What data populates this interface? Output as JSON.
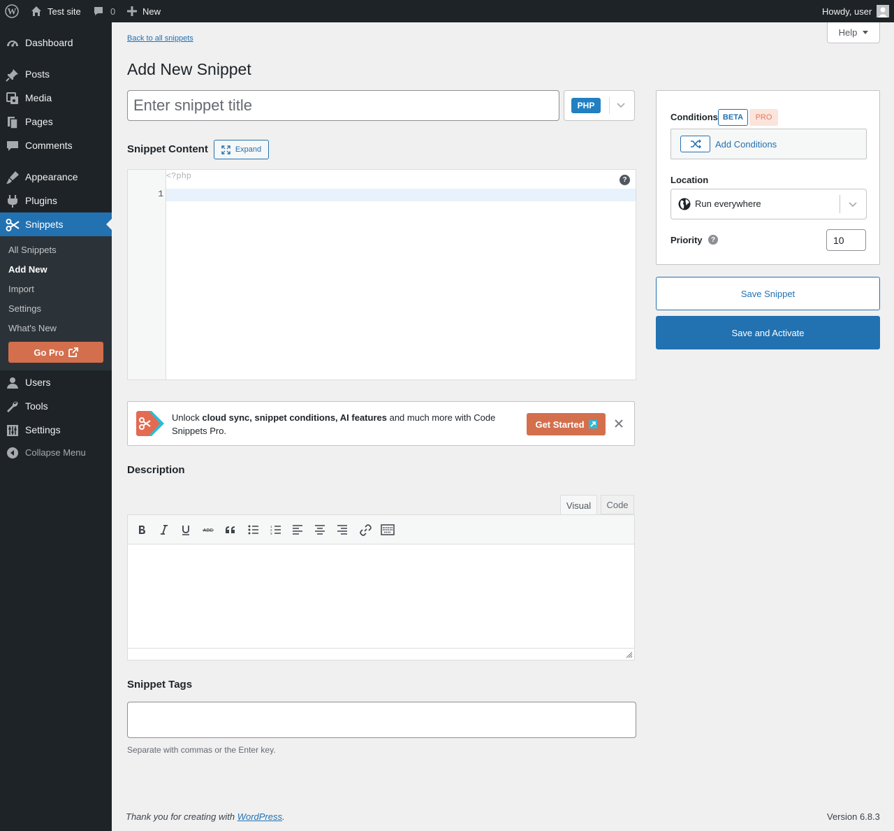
{
  "adminbar": {
    "site_name": "Test site",
    "comments_count": "0",
    "new_label": "New",
    "howdy": "Howdy, user"
  },
  "sidebar": {
    "items": [
      {
        "label": "Dashboard",
        "icon": "dashboard-icon"
      },
      {
        "label": "Posts",
        "icon": "pin-icon"
      },
      {
        "label": "Media",
        "icon": "media-icon"
      },
      {
        "label": "Pages",
        "icon": "pages-icon"
      },
      {
        "label": "Comments",
        "icon": "comment-icon"
      },
      {
        "label": "Appearance",
        "icon": "brush-icon"
      },
      {
        "label": "Plugins",
        "icon": "plug-icon"
      },
      {
        "label": "Snippets",
        "icon": "scissors-icon",
        "current": true
      }
    ],
    "submenu": [
      "All Snippets",
      "Add New",
      "Import",
      "Settings",
      "What's New"
    ],
    "go_pro": "Go Pro",
    "items_after": [
      {
        "label": "Users",
        "icon": "user-icon"
      },
      {
        "label": "Tools",
        "icon": "wrench-icon"
      },
      {
        "label": "Settings",
        "icon": "settings-icon"
      }
    ],
    "collapse": "Collapse Menu"
  },
  "main": {
    "back_link": "Back to all snippets",
    "help": "Help",
    "title": "Add New Snippet",
    "title_placeholder": "Enter snippet title",
    "language": "PHP",
    "content_heading": "Snippet Content",
    "expand": "Expand",
    "code_prefix": "<?php",
    "line_number": "1",
    "editor_help": "?",
    "promo": {
      "text_1": "Unlock ",
      "bold": "cloud sync, snippet conditions, AI features",
      "text_2": " and much more with Code Snippets Pro.",
      "button": "Get Started"
    },
    "description_heading": "Description",
    "tabs": [
      "Visual",
      "Code"
    ],
    "toolbar": [
      "bold",
      "italic",
      "underline",
      "strikethrough",
      "blockquote",
      "bulleted-list",
      "numbered-list",
      "align-left",
      "align-center",
      "align-right",
      "link",
      "toolbar-toggle"
    ],
    "tags_heading": "Snippet Tags",
    "tags_hint": "Separate with commas or the Enter key."
  },
  "sidepanel": {
    "conditions_label": "Conditions",
    "beta": "BETA",
    "pro": "PRO",
    "add_conditions": "Add Conditions",
    "location_label": "Location",
    "location_value": "Run everywhere",
    "priority_label": "Priority",
    "priority_value": "10",
    "save": "Save Snippet",
    "save_activate": "Save and Activate"
  },
  "footer": {
    "thanks": "Thank you for creating with ",
    "wp_link": "WordPress",
    "period": ".",
    "version": "Version 6.8.3"
  },
  "colors": {
    "admin_dark": "#1d2327",
    "primary": "#2271b1",
    "accent_orange": "#d46f4d",
    "page_bg": "#f0f0f1"
  }
}
